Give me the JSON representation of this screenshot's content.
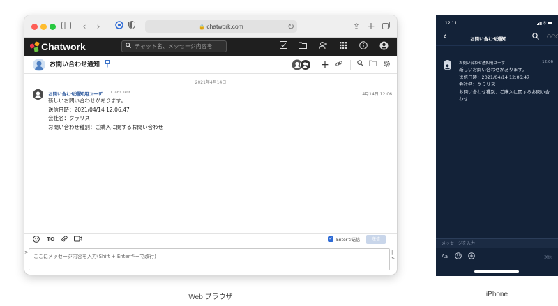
{
  "browser": {
    "url": "chatwork.com",
    "app_name": "Chatwork",
    "search_placeholder": "チャット名、メッセージ内容を",
    "room_title": "お問い合わせ通知",
    "timeline": {
      "date_divider": "2021年4月14日",
      "message": {
        "sender": "お問い合わせ通知用ユーザ",
        "sender_sub": "Claris Test",
        "time": "4月14日 12:06",
        "lines": [
          "新しいお問い合わせがあります。",
          "送信日時：2021/04/14 12:06:47",
          "会社名：クラリス",
          "お問い合わせ種別：ご購入に関するお問い合わせ"
        ]
      }
    },
    "composer": {
      "to_label": "TO",
      "enter_label": "Enterで送信",
      "send_label": "送信",
      "placeholder": "ここにメッセージ内容を入力(Shift + Enterキーで改行)"
    },
    "caption": "Web ブラウザ"
  },
  "phone": {
    "clock": "12:11",
    "title": "お問い合わせ通知",
    "message": {
      "sender": "お問い合わせ通知用ユーザ",
      "time": "12:06",
      "lines": [
        "新しいお問い合わせがあります。",
        "送信日時：2021/04/14 12:06:47",
        "会社名：クラリス",
        "お問い合わせ種別：ご購入に関するお問い合わせ"
      ]
    },
    "input_placeholder": "メッセージを入力",
    "aa_label": "Aa",
    "send_label": "送信",
    "caption": "iPhone"
  },
  "colors": {
    "traffic_red": "#fe5f57",
    "traffic_yellow": "#febc2e",
    "traffic_green": "#28c840",
    "app_bar": "#1f1f1f",
    "logo_red": "#f0384b",
    "logo_orange": "#f7a11a",
    "logo_green": "#69c83f",
    "link_blue": "#2e5a9e",
    "phone_bg": "#132238"
  },
  "icons": [
    "sidebar-icon",
    "back-icon",
    "forward-icon",
    "password-icon",
    "shield-icon",
    "lock-icon",
    "reload-icon",
    "share-icon",
    "new-tab-icon",
    "tabs-icon",
    "search-icon",
    "task-icon",
    "folder-icon",
    "add-contact-icon",
    "apps-icon",
    "info-icon",
    "account-icon",
    "pin-icon",
    "members-icon",
    "plus-icon",
    "link-icon",
    "settings-icon",
    "emoji-icon",
    "attach-icon",
    "video-icon",
    "check-icon"
  ]
}
